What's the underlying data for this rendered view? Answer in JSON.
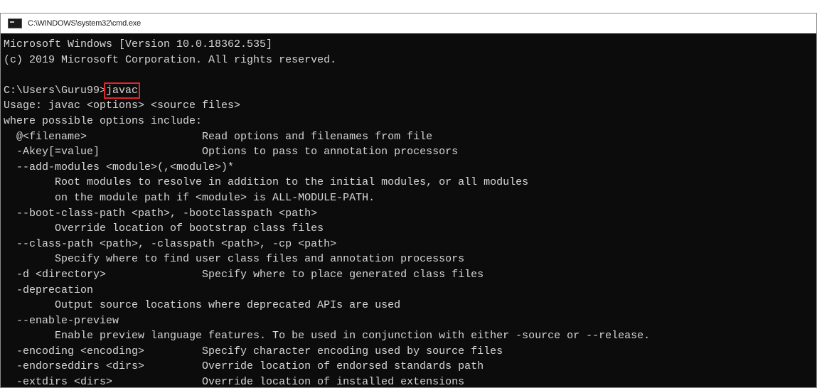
{
  "window": {
    "title": "C:\\WINDOWS\\system32\\cmd.exe",
    "icon": "cmd-icon"
  },
  "console": {
    "header_lines": [
      "Microsoft Windows [Version 10.0.18362.535]",
      "(c) 2019 Microsoft Corporation. All rights reserved.",
      ""
    ],
    "prompt": "C:\\Users\\Guru99>",
    "command": "javac",
    "output_lines": [
      "Usage: javac <options> <source files>",
      "where possible options include:",
      "  @<filename>                  Read options and filenames from file",
      "  -Akey[=value]                Options to pass to annotation processors",
      "  --add-modules <module>(,<module>)*",
      "        Root modules to resolve in addition to the initial modules, or all modules",
      "        on the module path if <module> is ALL-MODULE-PATH.",
      "  --boot-class-path <path>, -bootclasspath <path>",
      "        Override location of bootstrap class files",
      "  --class-path <path>, -classpath <path>, -cp <path>",
      "        Specify where to find user class files and annotation processors",
      "  -d <directory>               Specify where to place generated class files",
      "  -deprecation",
      "        Output source locations where deprecated APIs are used",
      "  --enable-preview",
      "        Enable preview language features. To be used in conjunction with either -source or --release.",
      "  -encoding <encoding>         Specify character encoding used by source files",
      "  -endorseddirs <dirs>         Override location of endorsed standards path",
      "  -extdirs <dirs>              Override location of installed extensions"
    ]
  },
  "colors": {
    "console_bg": "#0c0c0c",
    "console_text": "#d6d6d6",
    "highlight_box": "#e0262c"
  }
}
